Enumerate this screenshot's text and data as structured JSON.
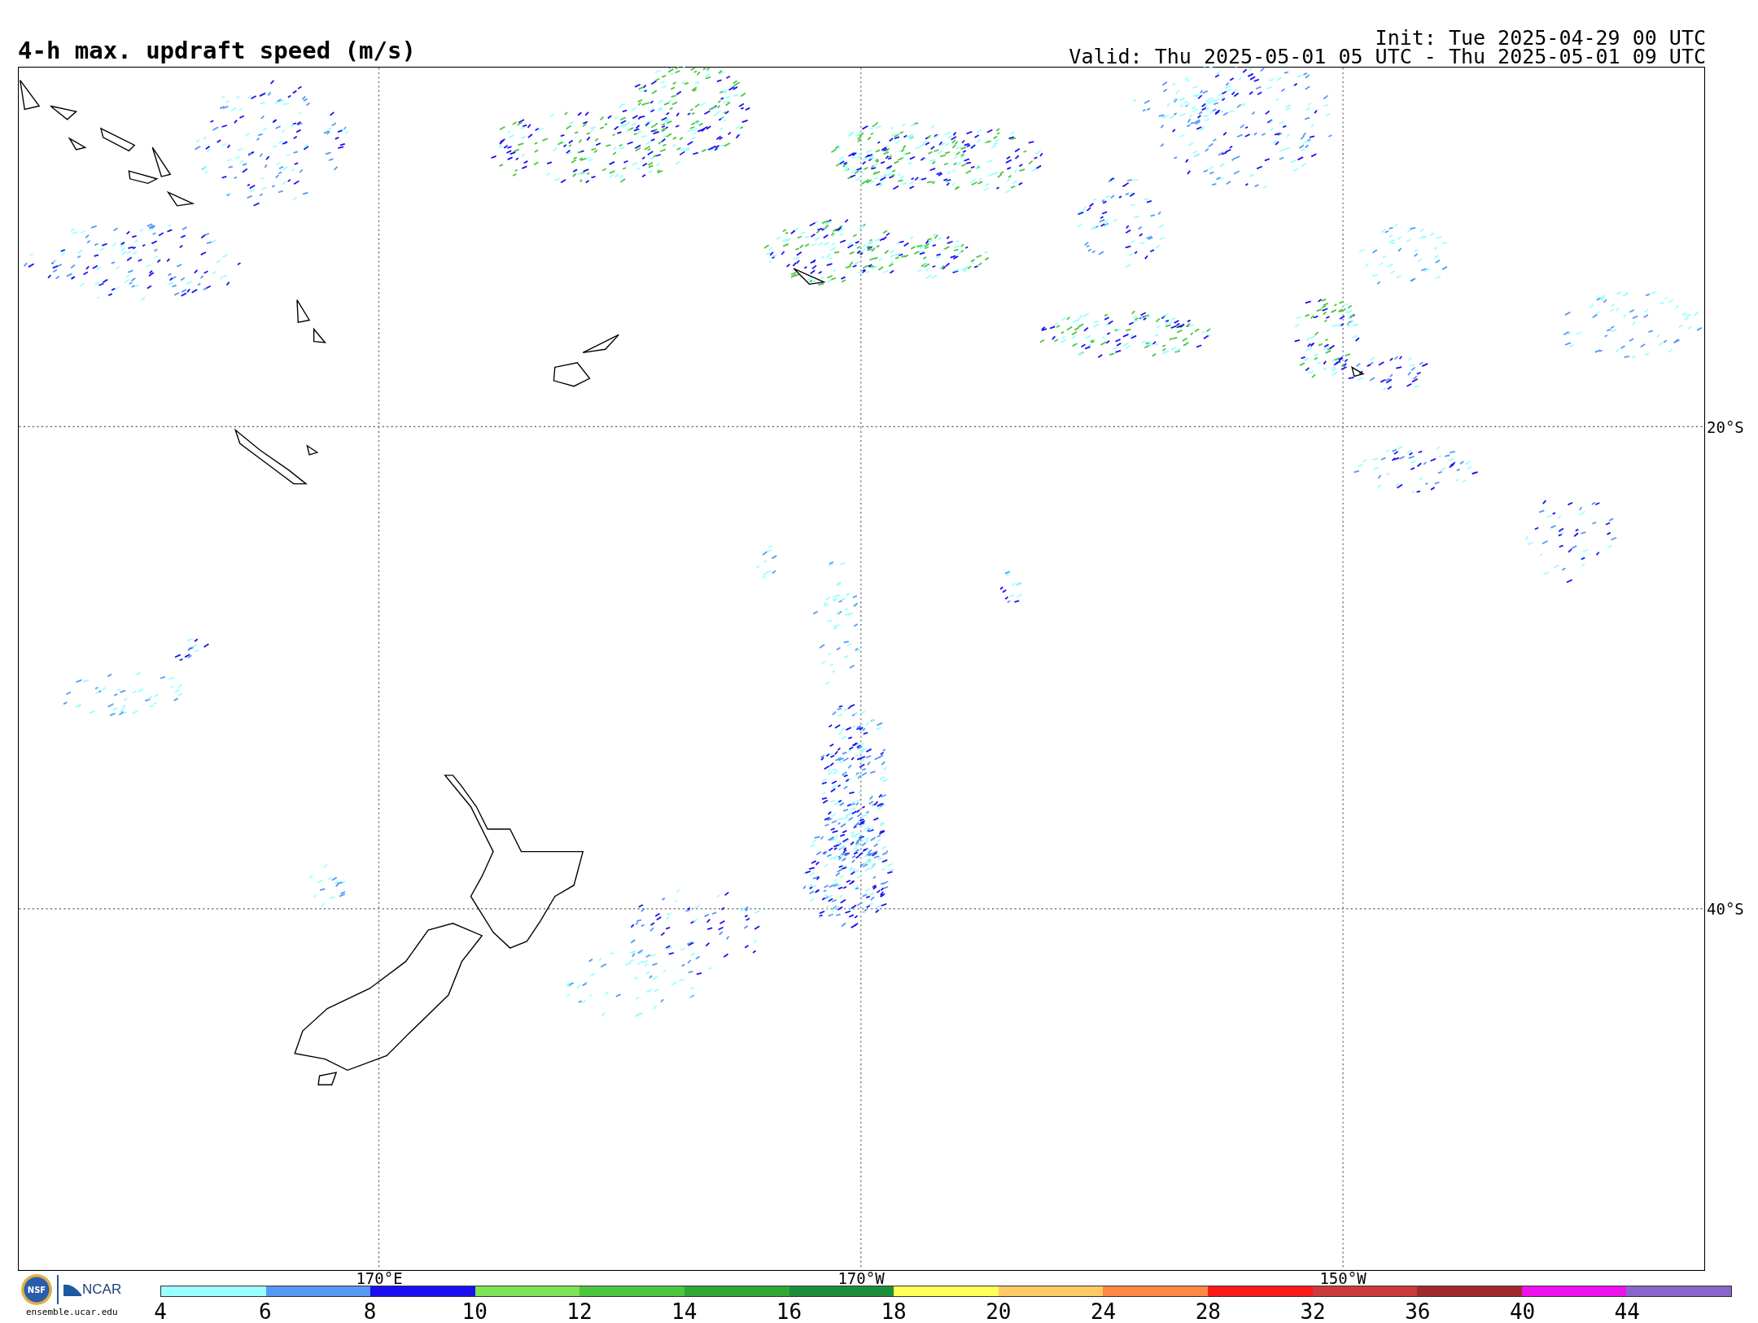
{
  "title": "4-h max. updraft speed (m/s)",
  "init": "Init: Tue 2025-04-29 00 UTC",
  "valid": "Valid: Thu 2025-05-01 05 UTC - Thu 2025-05-01 09 UTC",
  "map": {
    "latitude_labels": [
      "20°S",
      "40°S"
    ],
    "longitude_labels": [
      "170°E",
      "170°W",
      "150°W"
    ]
  },
  "colorbar": [
    {
      "label": "4",
      "color": "#99ffff"
    },
    {
      "label": "6",
      "color": "#5599f5"
    },
    {
      "label": "8",
      "color": "#1a0ff0"
    },
    {
      "label": "10",
      "color": "#7ee356"
    },
    {
      "label": "12",
      "color": "#4cc63f"
    },
    {
      "label": "14",
      "color": "#2fa838"
    },
    {
      "label": "16",
      "color": "#1d8f3c"
    },
    {
      "label": "18",
      "color": "#ffff55"
    },
    {
      "label": "20",
      "color": "#ffc966"
    },
    {
      "label": "24",
      "color": "#ff8844"
    },
    {
      "label": "28",
      "color": "#ff1a1a"
    },
    {
      "label": "32",
      "color": "#cc3a3a"
    },
    {
      "label": "36",
      "color": "#a02a2a"
    },
    {
      "label": "40",
      "color": "#ee11ee"
    },
    {
      "label": "44",
      "color": "#8866cc"
    }
  ],
  "logo": {
    "badge": "NSF",
    "name": "NCAR",
    "site": "ensemble.ucar.edu"
  }
}
